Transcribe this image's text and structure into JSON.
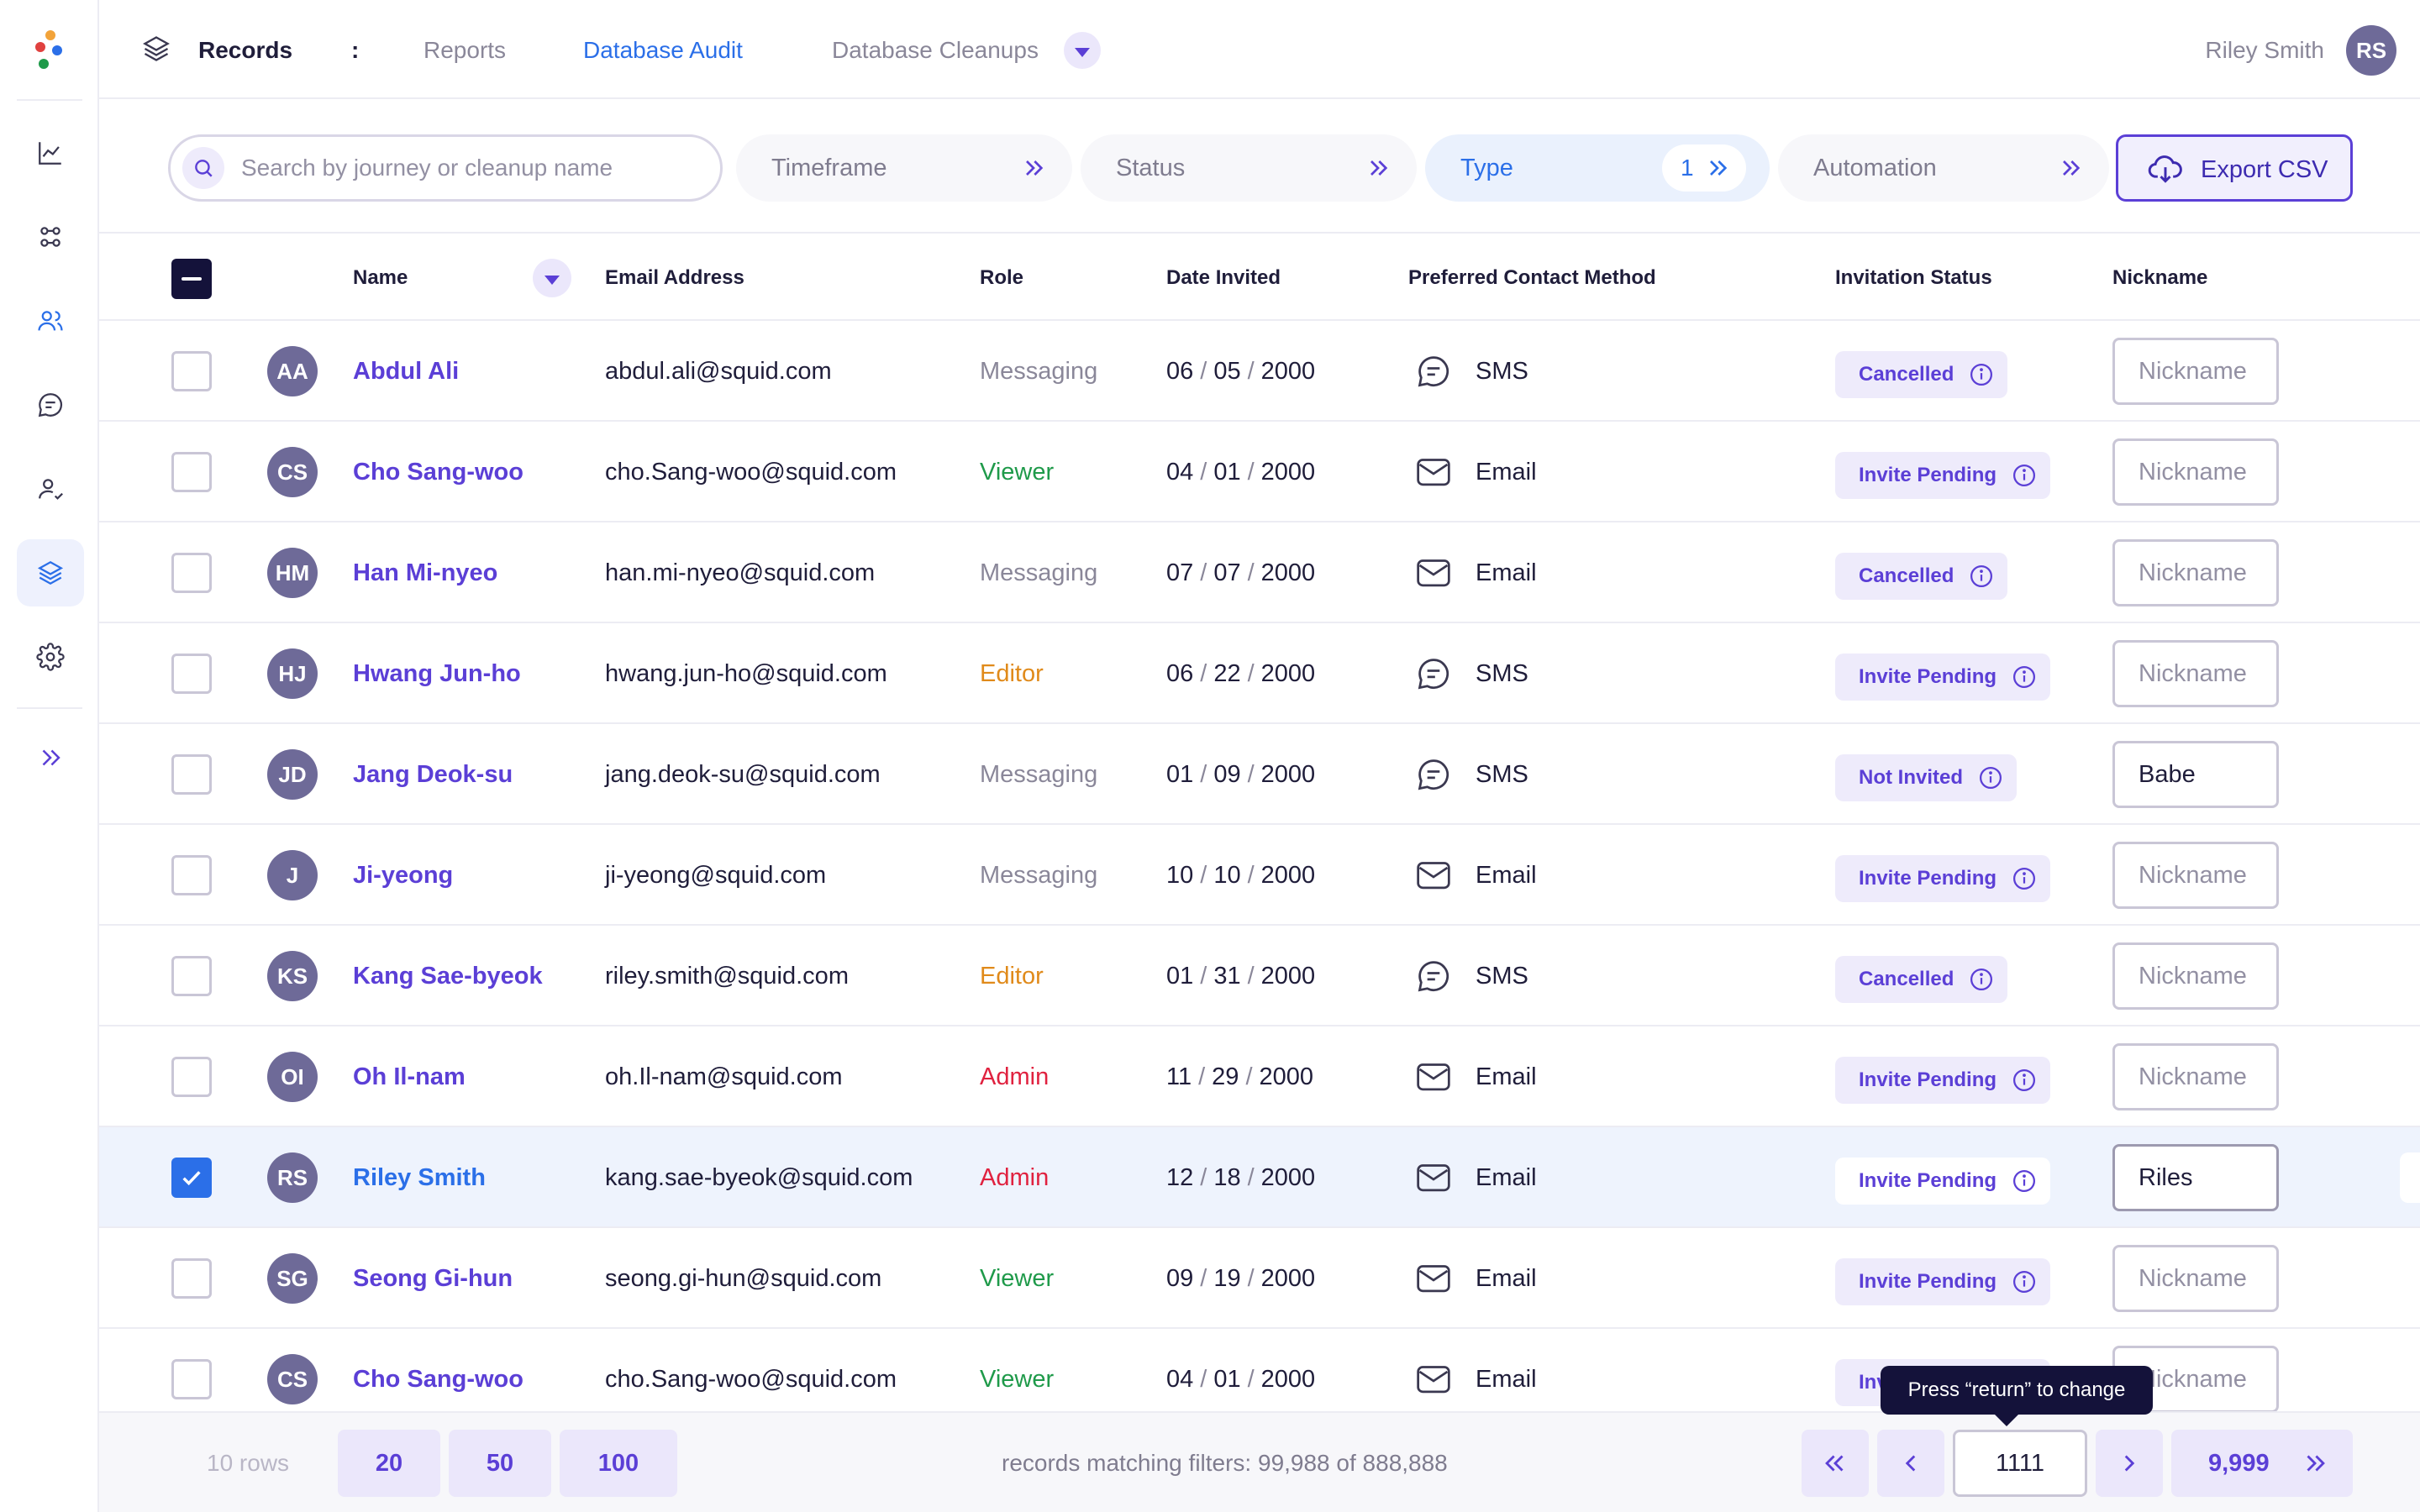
{
  "header": {
    "root": "Records",
    "separator": ":",
    "tabs": [
      {
        "label": "Reports",
        "active": false
      },
      {
        "label": "Database Audit",
        "active": true
      },
      {
        "label": "Database Cleanups",
        "active": false
      }
    ],
    "user_name": "Riley Smith",
    "user_initials": "RS"
  },
  "filters": {
    "search_placeholder": "Search by journey or cleanup name",
    "timeframe": "Timeframe",
    "status": "Status",
    "type": "Type",
    "type_count": "1",
    "automation": "Automation",
    "export": "Export CSV"
  },
  "columns": {
    "name": "Name",
    "email": "Email Address",
    "role": "Role",
    "date": "Date Invited",
    "method": "Preferred Contact Method",
    "status": "Invitation Status",
    "nickname": "Nickname"
  },
  "nickname_placeholder": "Nickname",
  "rows": [
    {
      "initials": "AA",
      "name": "Abdul Ali",
      "email": "abdul.ali@squid.com",
      "role": "Messaging",
      "date": [
        "06",
        "05",
        "2000"
      ],
      "method": "SMS",
      "status": "Cancelled",
      "nickname": "",
      "selected": false
    },
    {
      "initials": "CS",
      "name": "Cho Sang-woo",
      "email": "cho.Sang-woo@squid.com",
      "role": "Viewer",
      "date": [
        "04",
        "01",
        "2000"
      ],
      "method": "Email",
      "status": "Invite Pending",
      "nickname": "",
      "selected": false
    },
    {
      "initials": "HM",
      "name": "Han Mi-nyeo",
      "email": "han.mi-nyeo@squid.com",
      "role": "Messaging",
      "date": [
        "07",
        "07",
        "2000"
      ],
      "method": "Email",
      "status": "Cancelled",
      "nickname": "",
      "selected": false
    },
    {
      "initials": "HJ",
      "name": "Hwang Jun-ho",
      "email": "hwang.jun-ho@squid.com",
      "role": "Editor",
      "date": [
        "06",
        "22",
        "2000"
      ],
      "method": "SMS",
      "status": "Invite Pending",
      "nickname": "",
      "selected": false
    },
    {
      "initials": "JD",
      "name": "Jang Deok-su",
      "email": "jang.deok-su@squid.com",
      "role": "Messaging",
      "date": [
        "01",
        "09",
        "2000"
      ],
      "method": "SMS",
      "status": "Not Invited",
      "nickname": "Babe",
      "selected": false
    },
    {
      "initials": "J",
      "name": "Ji-yeong",
      "email": "ji-yeong@squid.com",
      "role": "Messaging",
      "date": [
        "10",
        "10",
        "2000"
      ],
      "method": "Email",
      "status": "Invite Pending",
      "nickname": "",
      "selected": false
    },
    {
      "initials": "KS",
      "name": "Kang Sae-byeok",
      "email": "riley.smith@squid.com",
      "role": "Editor",
      "date": [
        "01",
        "31",
        "2000"
      ],
      "method": "SMS",
      "status": "Cancelled",
      "nickname": "",
      "selected": false
    },
    {
      "initials": "OI",
      "name": "Oh Il-nam",
      "email": "oh.Il-nam@squid.com",
      "role": "Admin",
      "date": [
        "11",
        "29",
        "2000"
      ],
      "method": "Email",
      "status": "Invite Pending",
      "nickname": "",
      "selected": false
    },
    {
      "initials": "RS",
      "name": "Riley Smith",
      "email": "kang.sae-byeok@squid.com",
      "role": "Admin",
      "date": [
        "12",
        "18",
        "2000"
      ],
      "method": "Email",
      "status": "Invite Pending",
      "nickname": "Riles",
      "selected": true
    },
    {
      "initials": "SG",
      "name": "Seong Gi-hun",
      "email": "seong.gi-hun@squid.com",
      "role": "Viewer",
      "date": [
        "09",
        "19",
        "2000"
      ],
      "method": "Email",
      "status": "Invite Pending",
      "nickname": "",
      "selected": false
    },
    {
      "initials": "CS",
      "name": "Cho Sang-woo",
      "email": "cho.Sang-woo@squid.com",
      "role": "Viewer",
      "date": [
        "04",
        "01",
        "2000"
      ],
      "method": "Email",
      "status": "Invite Pending",
      "nickname": "",
      "selected": false
    }
  ],
  "footer": {
    "rows_label": "10 rows",
    "page_sizes": [
      "20",
      "50",
      "100"
    ],
    "matching": "records matching filters:  99,988 of 888,888",
    "page_value": "1111",
    "last_page": "9,999",
    "tooltip": "Press “return” to change"
  },
  "colors": {
    "accent": "#5b3fd6",
    "link_blue": "#2b6fe8",
    "viewer": "#1f9a4a",
    "editor": "#e08a1a",
    "admin": "#e0213f"
  }
}
